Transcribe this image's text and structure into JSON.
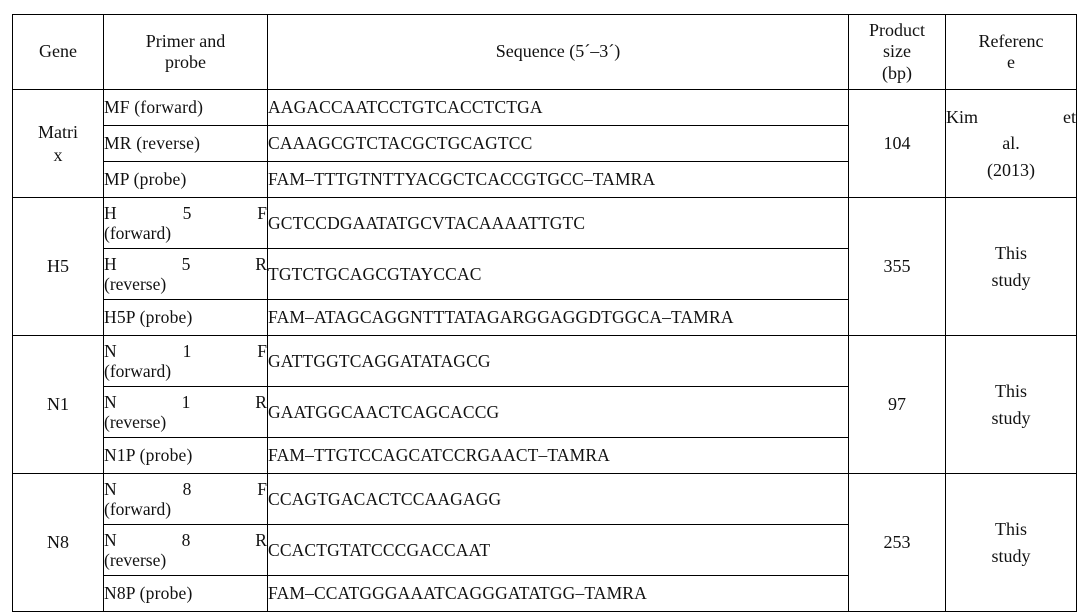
{
  "table": {
    "headers": {
      "gene": "Gene",
      "primer_and_probe_line1": "Primer and",
      "primer_and_probe_line2": "probe",
      "sequence": "Sequence (5´–3´)",
      "product_size_line1": "Product",
      "product_size_line2": "size",
      "product_size_line3": "(bp)",
      "reference_line1": "Referenc",
      "reference_line2": "e"
    },
    "groups": [
      {
        "gene_line1": "Matri",
        "gene_line2": "x",
        "product_size": "104",
        "reference_line1_a": "Kim",
        "reference_line1_b": "et",
        "reference_line2": "al.",
        "reference_line3": "(2013)",
        "rows": [
          {
            "label_style": "simple",
            "label": "MF (forward)",
            "sequence": "AAGACCAATCCTGTCACCTCTGA"
          },
          {
            "label_style": "simple",
            "label": "MR (reverse)",
            "sequence": "CAAAGCGTCTACGCTGCAGTCC"
          },
          {
            "label_style": "simple",
            "label": "MP (probe)",
            "sequence": "FAM–TTTGTNTTYACGCTCACCGTGCC–TAMRA"
          }
        ]
      },
      {
        "gene_line1": "H5",
        "gene_line2": "",
        "product_size": "355",
        "reference_line1_a": "This",
        "reference_line1_b": "",
        "reference_line2": "study",
        "reference_line3": "",
        "rows": [
          {
            "label_style": "spread",
            "label_tok1": "H",
            "label_tok2": "5",
            "label_tok3": "F",
            "label_line2": "(forward)",
            "sequence": "GCTCCDGAATATGCVTACAAAATTGTC"
          },
          {
            "label_style": "spread",
            "label_tok1": "H",
            "label_tok2": "5",
            "label_tok3": "R",
            "label_line2": "(reverse)",
            "sequence": "TGTCTGCAGCGTAYCCAC"
          },
          {
            "label_style": "simple",
            "label": "H5P (probe)",
            "sequence": "FAM–ATAGCAGGNTTTATAGARGGAGGDTGGCA–TAMRA"
          }
        ]
      },
      {
        "gene_line1": "N1",
        "gene_line2": "",
        "product_size": "97",
        "reference_line1_a": "This",
        "reference_line1_b": "",
        "reference_line2": "study",
        "reference_line3": "",
        "rows": [
          {
            "label_style": "spread",
            "label_tok1": "N",
            "label_tok2": "1",
            "label_tok3": "F",
            "label_line2": "(forward)",
            "sequence": "GATTGGTCAGGATATAGCG"
          },
          {
            "label_style": "spread",
            "label_tok1": "N",
            "label_tok2": "1",
            "label_tok3": "R",
            "label_line2": "(reverse)",
            "sequence": "GAATGGCAACTCAGCACCG"
          },
          {
            "label_style": "simple",
            "label": "N1P (probe)",
            "sequence": "FAM–TTGTCCAGCATCCRGAACT–TAMRA"
          }
        ]
      },
      {
        "gene_line1": "N8",
        "gene_line2": "",
        "product_size": "253",
        "reference_line1_a": "This",
        "reference_line1_b": "",
        "reference_line2": "study",
        "reference_line3": "",
        "rows": [
          {
            "label_style": "spread",
            "label_tok1": "N",
            "label_tok2": "8",
            "label_tok3": "F",
            "label_line2": "(forward)",
            "sequence": "CCAGTGACACTCCAAGAGG"
          },
          {
            "label_style": "spread",
            "label_tok1": "N",
            "label_tok2": "8",
            "label_tok3": "R",
            "label_line2": "(reverse)",
            "sequence": "CCACTGTATCCCGACCAAT"
          },
          {
            "label_style": "simple",
            "label": "N8P (probe)",
            "sequence": "FAM–CCATGGGAAATCAGGGATATGG–TAMRA"
          }
        ]
      }
    ]
  }
}
